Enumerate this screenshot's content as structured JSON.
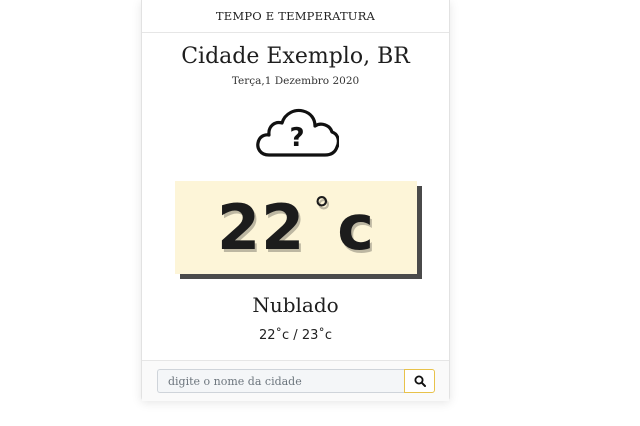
{
  "header": {
    "title": "TEMPO E TEMPERATURA"
  },
  "location": {
    "city": "Cidade Exemplo, BR",
    "date": "Terça,1 Dezembro 2020"
  },
  "weather": {
    "icon": "cloud-question-icon",
    "temperature": "22",
    "unit_symbol": "°",
    "unit": "c",
    "condition": "Nublado",
    "range": "22˚c / 23˚c"
  },
  "search": {
    "placeholder": "digite o nome da cidade",
    "value": "",
    "button_icon": "search-icon"
  },
  "colors": {
    "temp_box_bg": "#fdf5d8",
    "search_button_border": "#e8c24a"
  }
}
